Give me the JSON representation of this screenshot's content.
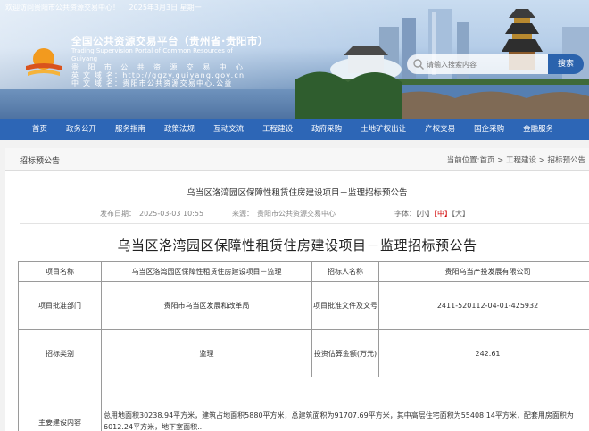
{
  "topbar": {
    "welcome": "欢迎访问贵阳市公共资源交易中心！",
    "date": "2025年3月3日 星期一"
  },
  "header": {
    "title_cn": "全国公共资源交易平台（贵州省·贵阳市）",
    "title_en": "Trading Supervision Portal of Common Resources of Guiyang",
    "en_domain_label": "英 文 域 名：",
    "en_domain": "http://ggzy.guiyang.gov.cn",
    "cn_domain_label": "中 文 域 名：",
    "cn_domain": "贵阳市公共资源交易中心.公益",
    "row_label": "贵　阳　市　公　共　资　源　交　易　中　心"
  },
  "search": {
    "placeholder": "请输入搜索内容",
    "button_label": "搜索"
  },
  "nav": {
    "items": [
      "首页",
      "政务公开",
      "服务指南",
      "政策法规",
      "互动交流",
      "工程建设",
      "政府采购",
      "土地矿权出让",
      "产权交易",
      "国企采购",
      "金融服务"
    ]
  },
  "breadcrumb": {
    "section": "招标预公告",
    "path": "当前位置:首页 > 工程建设 > 招标预公告"
  },
  "article": {
    "header_title": "乌当区洛湾园区保障性租赁住房建设项目－监理招标预公告",
    "publish_time": "发布日期：　2025-03-03 10:55",
    "source": "来源：　贵阳市公共资源交易中心",
    "font_label": "字体：",
    "font_small": "【小】",
    "font_mid": "【中】",
    "font_large": "【大】",
    "main_title": "乌当区洛湾园区保障性租赁住房建设项目－监理招标预公告"
  },
  "table": {
    "rows": [
      {
        "k1": "项目名称",
        "v1": "乌当区洛湾园区保障性租赁住房建设项目－监理",
        "k2": "招标人名称",
        "v2": "贵阳乌当产投发展有限公司"
      },
      {
        "k1": "项目批准部门",
        "v1": "贵阳市乌当区发展和改革局",
        "k2": "项目批准文件及文号",
        "v2": "2411-520112-04-01-425932"
      },
      {
        "k1": "招标类别",
        "v1": "监理",
        "k2": "投资估算金额(万元)",
        "v2": "242.61"
      }
    ],
    "content_label": "主要建设内容",
    "content_text": "总用地面积30238.94平方米，建筑占地面积5880平方米，总建筑面积为91707.69平方米，其中高层住宅面积为55408.14平方米，配套用房面积为6012.24平方米，地下室面积..."
  },
  "colors": {
    "nav_bg": "#2d66b6",
    "search_btn": "#2b63ad",
    "font_mid_red": "#d00000"
  }
}
